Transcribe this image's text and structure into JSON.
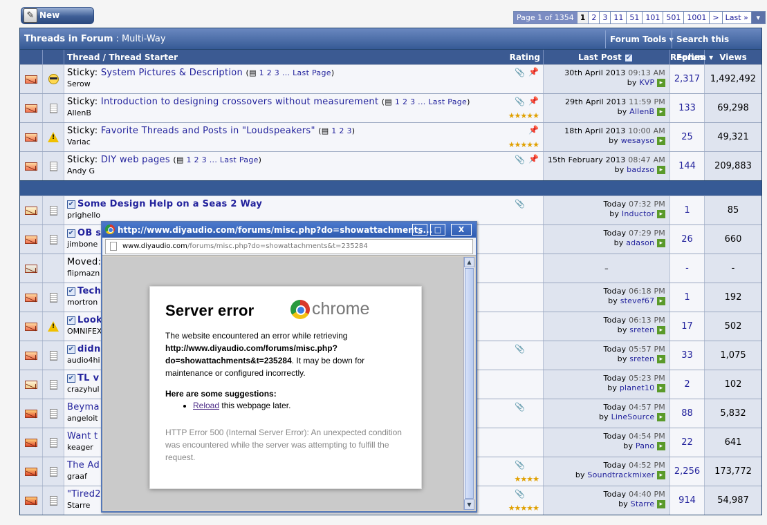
{
  "new_thread_label": "New Thread",
  "pagenav": {
    "label": "Page 1 of 1354",
    "pages": [
      "1",
      "2",
      "3",
      "11",
      "51",
      "101",
      "501",
      "1001",
      ">",
      "Last »"
    ],
    "current": "1"
  },
  "forum": {
    "title": "Threads in Forum",
    "name": ": Multi-Way",
    "forum_tools": "Forum Tools",
    "search": "Search this Forum"
  },
  "columns": {
    "thread": "Thread / Thread Starter",
    "rating": "Rating",
    "last_post": "Last Post",
    "replies": "Replies",
    "views": "Views"
  },
  "sticky_prefix": "Sticky:",
  "sticky_threads": [
    {
      "title": "System Pictures & Description",
      "starter": "Serow",
      "pages": "1 2 3 ... Last Page",
      "date": "30th April 2013",
      "time": "09:13 AM",
      "by": "KVP",
      "replies": "2,317",
      "views": "1,492,492",
      "icon": "smiley",
      "stars": "",
      "clip": true,
      "pin": true
    },
    {
      "title": "Introduction to designing crossovers without measurement",
      "starter": "AllenB",
      "pages": "1 2 3 ... Last Page",
      "date": "29th April 2013",
      "time": "11:59 PM",
      "by": "AllenB",
      "replies": "133",
      "views": "69,298",
      "icon": "doc",
      "stars": "★★★★★",
      "clip": true,
      "pin": true
    },
    {
      "title": "Favorite Threads and Posts in \"Loudspeakers\"",
      "starter": "Variac",
      "pages": "1 2 3",
      "date": "18th April 2013",
      "time": "10:00 AM",
      "by": "wesayso",
      "replies": "25",
      "views": "49,321",
      "icon": "warn",
      "stars": "★★★★★",
      "clip": false,
      "pin": true
    },
    {
      "title": "DIY web pages",
      "starter": "Andy G",
      "pages": "1 2 3 ... Last Page",
      "date": "15th February 2013",
      "time": "08:47 AM",
      "by": "badzso",
      "replies": "144",
      "views": "209,883",
      "icon": "doc",
      "stars": "",
      "clip": true,
      "pin": true
    }
  ],
  "threads": [
    {
      "title": "Some Design Help on a Seas 2 Way",
      "starter": "prighello",
      "time": "07:32 PM",
      "by": "Inductor",
      "replies": "1",
      "views": "85",
      "env": "read",
      "icon": "doc",
      "check": true,
      "bold": true,
      "stars": "",
      "clip": true
    },
    {
      "title": "OB s",
      "starter": "jimbone",
      "time": "07:29 PM",
      "by": "adason",
      "replies": "26",
      "views": "660",
      "env": "hot",
      "icon": "doc",
      "check": true,
      "bold": true,
      "stars": "",
      "clip": false
    },
    {
      "title": "Moved:",
      "starter": "flipmazn",
      "time": "",
      "by": "",
      "replies": "-",
      "views": "-",
      "env": "moved",
      "icon": "",
      "check": false,
      "bold": false,
      "stars": "",
      "clip": false
    },
    {
      "title": "Tech",
      "starter": "mortron",
      "time": "06:18 PM",
      "by": "stevef67",
      "replies": "1",
      "views": "192",
      "env": "hot",
      "icon": "doc",
      "check": true,
      "bold": true,
      "stars": "",
      "clip": false
    },
    {
      "title": "Look",
      "starter": "OMNIFEX",
      "time": "06:13 PM",
      "by": "sreten",
      "replies": "17",
      "views": "502",
      "env": "hot",
      "icon": "warn",
      "check": true,
      "bold": true,
      "stars": "",
      "clip": false
    },
    {
      "title": "didn",
      "starter": "audio4hi",
      "time": "05:57 PM",
      "by": "sreten",
      "replies": "33",
      "views": "1,075",
      "env": "hot",
      "icon": "doc",
      "check": true,
      "bold": true,
      "stars": "",
      "clip": true
    },
    {
      "title": "TL v",
      "starter": "crazyhul",
      "time": "05:23 PM",
      "by": "planet10",
      "replies": "2",
      "views": "102",
      "env": "read",
      "icon": "doc",
      "check": true,
      "bold": true,
      "stars": "",
      "clip": false
    },
    {
      "title": "Beyma",
      "starter": "angeloit",
      "time": "04:57 PM",
      "by": "LineSource",
      "replies": "88",
      "views": "5,832",
      "env": "normal",
      "icon": "doc",
      "check": false,
      "bold": false,
      "stars": "",
      "clip": true
    },
    {
      "title": "Want t",
      "starter": "keager",
      "time": "04:54 PM",
      "by": "Pano",
      "replies": "22",
      "views": "641",
      "env": "normal",
      "icon": "doc",
      "check": false,
      "bold": false,
      "stars": "",
      "clip": false
    },
    {
      "title": "The Ad",
      "starter": "graaf",
      "time": "04:52 PM",
      "by": "Soundtrackmixer",
      "replies": "2,256",
      "views": "173,772",
      "env": "normal",
      "icon": "doc",
      "check": false,
      "bold": false,
      "stars": "★★★★",
      "clip": true
    },
    {
      "title": "\"Tired2",
      "starter": "Starre",
      "time": "04:40 PM",
      "by": "Starre",
      "replies": "914",
      "views": "54,987",
      "env": "normal",
      "icon": "doc",
      "check": false,
      "bold": false,
      "stars": "★★★★★",
      "clip": true
    }
  ],
  "today_label": "Today",
  "by_label": "by",
  "moved_dash": "–",
  "popup": {
    "title": "http://www.diyaudio.com/forums/misc.php?do=showattachments...",
    "url_domain": "www.diyaudio.com",
    "url_rest": "/forums/misc.php?do=showattachments&t=235284",
    "minimize": "_",
    "maximize": "□",
    "close": "X"
  },
  "error": {
    "heading": "Server error",
    "brand": "chrome",
    "intro": "The website encountered an error while retrieving",
    "url_line1": "http://www.diyaudio.com/forums/misc.php?",
    "url_line2": "do=showattachments&t=235284",
    "intro_tail": ". It may be down for maintenance or configured incorrectly.",
    "sugg_title": "Here are some suggestions:",
    "reload": "Reload",
    "reload_tail": " this webpage later.",
    "http": "HTTP Error 500 (Internal Server Error): An unexpected condition was encountered while the server was attempting to fulfill the request."
  }
}
